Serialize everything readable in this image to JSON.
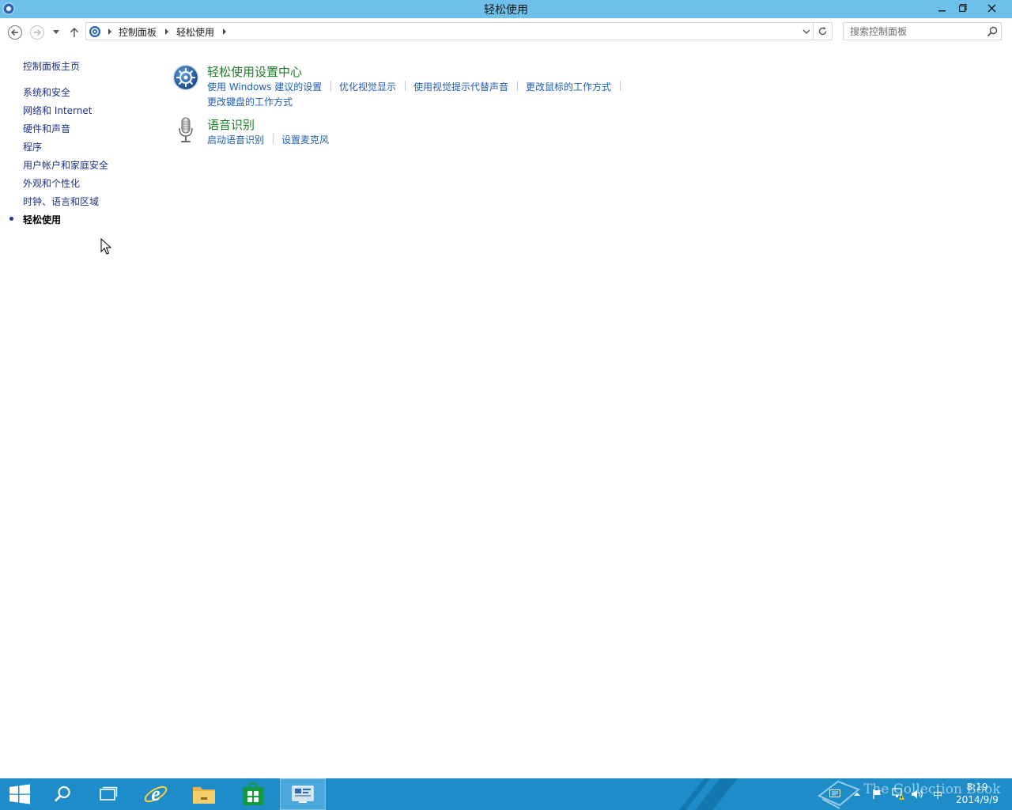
{
  "window": {
    "title": "轻松使用"
  },
  "address": {
    "crumbs": [
      "控制面板",
      "轻松使用"
    ]
  },
  "search": {
    "placeholder": "搜索控制面板"
  },
  "sidebar": {
    "home": "控制面板主页",
    "items": [
      "系统和安全",
      "网络和 Internet",
      "硬件和声音",
      "程序",
      "用户帐户和家庭安全",
      "外观和个性化",
      "时钟、语言和区域",
      "轻松使用"
    ]
  },
  "categories": [
    {
      "title": "轻松使用设置中心",
      "links": [
        "使用 Windows 建议的设置",
        "优化视觉显示",
        "使用视觉提示代替声音",
        "更改鼠标的工作方式",
        "更改键盘的工作方式"
      ]
    },
    {
      "title": "语音识别",
      "links": [
        "启动语音识别",
        "设置麦克风"
      ]
    }
  ],
  "taskbar": {
    "items": [
      "start-icon",
      "search-icon",
      "task-view-icon",
      "internet-explorer-icon",
      "file-explorer-icon",
      "store-icon",
      "control-panel-icon"
    ],
    "ime": "中",
    "clock_time": "8:19",
    "clock_date": "2014/9/9",
    "watermark": "The Collection Book"
  },
  "colors": {
    "titlebar": "#6cc0ea",
    "taskbar": "#1e8cc8",
    "category_title": "#1e7d28",
    "task_link": "#1e5fb4",
    "nav_link": "#1e3287"
  }
}
